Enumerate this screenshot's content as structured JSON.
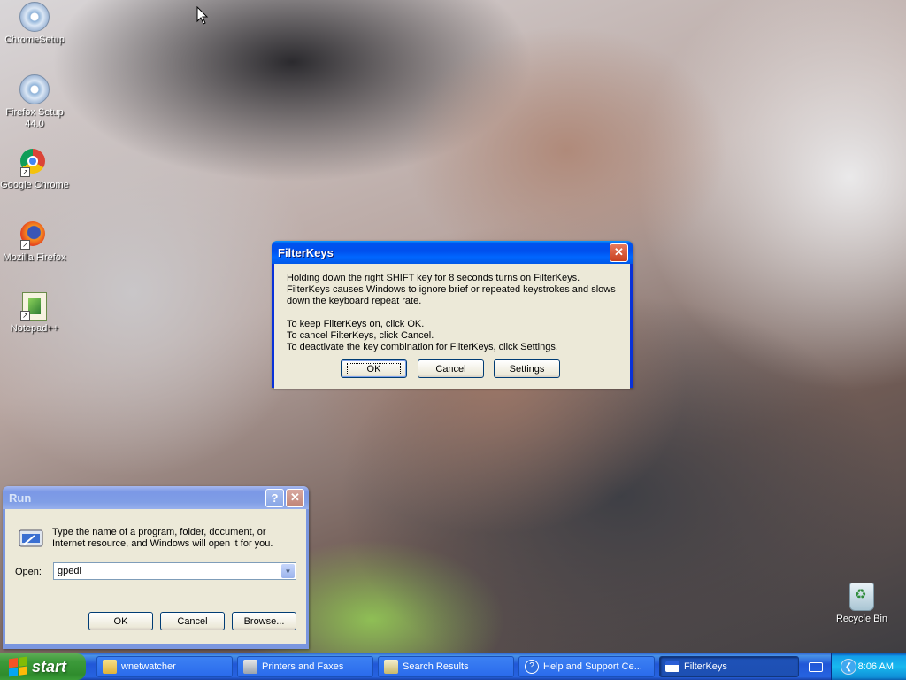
{
  "desktop": {
    "icons": [
      {
        "label": "ChromeSetup",
        "icon": "cd-setup-icon"
      },
      {
        "label": "Firefox Setup 44.0",
        "icon": "cd-setup-icon"
      },
      {
        "label": "Google Chrome",
        "icon": "chrome-icon"
      },
      {
        "label": "Mozilla Firefox",
        "icon": "firefox-icon"
      },
      {
        "label": "Notepad++",
        "icon": "notepadpp-icon"
      },
      {
        "label": "Recycle Bin",
        "icon": "recycle-bin-icon"
      }
    ]
  },
  "filterkeys": {
    "title": "FilterKeys",
    "message1": "Holding down the right SHIFT key for 8 seconds turns on FilterKeys. FilterKeys causes Windows to ignore brief or repeated keystrokes and slows down the keyboard repeat rate.",
    "line1": "To keep FilterKeys on, click OK.",
    "line2": "To cancel FilterKeys, click Cancel.",
    "line3": "To deactivate the key combination for FilterKeys, click Settings.",
    "ok": "OK",
    "cancel": "Cancel",
    "settings": "Settings"
  },
  "run": {
    "title": "Run",
    "description": "Type the name of a program, folder, document, or Internet resource, and Windows will open it for you.",
    "open_label": "Open:",
    "open_value": "gpedi",
    "ok": "OK",
    "cancel": "Cancel",
    "browse": "Browse..."
  },
  "taskbar": {
    "start": "start",
    "tasks": [
      {
        "label": "wnetwatcher",
        "icon": "folder-icon"
      },
      {
        "label": "Printers and Faxes",
        "icon": "printer-icon"
      },
      {
        "label": "Search Results",
        "icon": "search-results-icon"
      },
      {
        "label": "Help and Support Ce...",
        "icon": "help-icon"
      },
      {
        "label": "FilterKeys",
        "icon": "window-icon"
      }
    ],
    "clock": "8:06 AM"
  },
  "colors": {
    "xp_blue": "#0053ee",
    "dialog_face": "#ece9d8",
    "start_green": "#3c9a3a"
  }
}
